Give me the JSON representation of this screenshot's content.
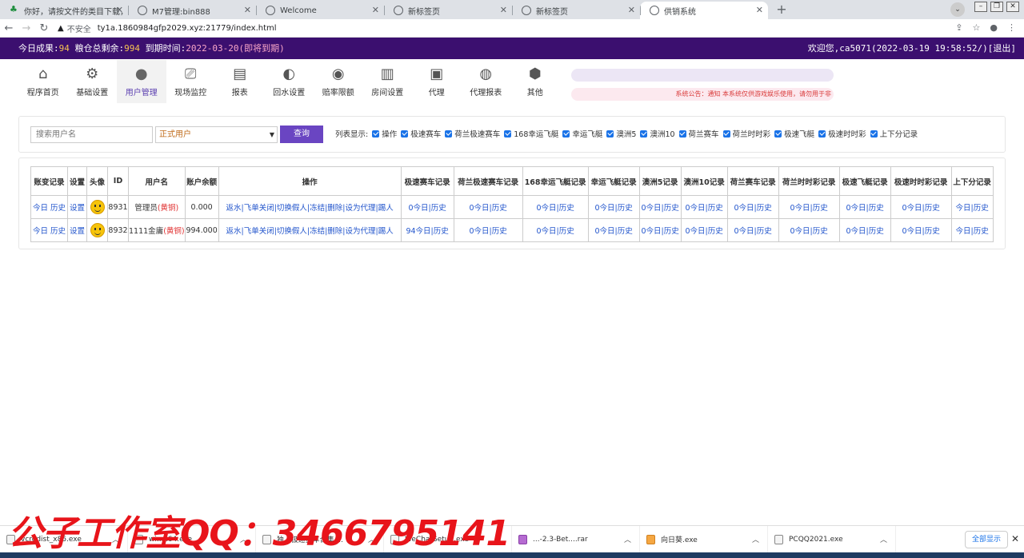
{
  "browser": {
    "tabs": [
      {
        "title": "你好，请按文件的类目下载，对…",
        "icon": "tree-icon"
      },
      {
        "title": "M7管理:bin888",
        "icon": "globe-icon"
      },
      {
        "title": "Welcome",
        "icon": "globe-icon"
      },
      {
        "title": "新标签页",
        "icon": "globe-icon"
      },
      {
        "title": "新标签页",
        "icon": "globe-icon"
      },
      {
        "title": "供销系统",
        "icon": "globe-icon",
        "active": true
      }
    ],
    "insecure_label": "不安全",
    "url": "ty1a.1860984gfp2029.xyz:21779/index.html"
  },
  "status_bar": {
    "today_label": "今日成果:",
    "today_value": "94",
    "grain_label": "粮仓总剩余:",
    "grain_value": "994",
    "expire_label": "到期时间:",
    "expire_value": "2022-03-20(即将到期)",
    "welcome": "欢迎您,ca5071(2022-03-19 19:58:52/)",
    "logout": "[退出]"
  },
  "nav": [
    {
      "label": "程序首页",
      "icon": "home-icon"
    },
    {
      "label": "基础设置",
      "icon": "gear-icon"
    },
    {
      "label": "用户管理",
      "icon": "user-icon",
      "active": true
    },
    {
      "label": "现场监控",
      "icon": "camera-icon"
    },
    {
      "label": "报表",
      "icon": "clipboard-icon"
    },
    {
      "label": "回水设置",
      "icon": "coin-icon"
    },
    {
      "label": "赔率限额",
      "icon": "car-icon"
    },
    {
      "label": "房间设置",
      "icon": "door-icon"
    },
    {
      "label": "代理",
      "icon": "agent-icon"
    },
    {
      "label": "代理报表",
      "icon": "chart-icon"
    },
    {
      "label": "其他",
      "icon": "box-icon"
    }
  ],
  "notice": "系统公告：通知 本系统仅供游戏娱乐使用，请勿用于非",
  "filter": {
    "search_placeholder": "搜索用户名",
    "user_type": "正式用户",
    "query_button": "查询",
    "columns_label": "列表显示:",
    "columns": [
      "操作",
      "极速赛车",
      "荷兰极速赛车",
      "168幸运飞艇",
      "幸运飞艇",
      "澳洲5",
      "澳洲10",
      "荷兰赛车",
      "荷兰时时彩",
      "极速飞艇",
      "极速时时彩",
      "上下分记录"
    ]
  },
  "table": {
    "headers": [
      "账变记录",
      "设置",
      "头像",
      "ID",
      "用户名",
      "账户余额",
      "操作",
      "极速赛车记录",
      "荷兰极速赛车记录",
      "168幸运飞艇记录",
      "幸运飞艇记录",
      "澳洲5记录",
      "澳洲10记录",
      "荷兰赛车记录",
      "荷兰时时彩记录",
      "极速飞艇记录",
      "极速时时彩记录",
      "上下分记录"
    ],
    "today": "今日",
    "history": "历史",
    "settings": "设置",
    "actions": "返水|飞单关闭|切换假人|冻结|删除|设为代理|踢人",
    "rows": [
      {
        "id": "8931",
        "username": "管理员",
        "tag": "(黄铜)",
        "balance": "0.000",
        "first_prefix": "0"
      },
      {
        "id": "8932",
        "username": "1111金庸",
        "tag": "(黄铜)",
        "balance": "994.000",
        "first_prefix": "94"
      }
    ],
    "record_prefix": "0"
  },
  "downloads": [
    {
      "name": "vcredist_x86.exe",
      "type": "exe"
    },
    {
      "name": "wi...x64.exe",
      "type": "exe"
    },
    {
      "name": "独...极速赛车合集....",
      "type": "doc"
    },
    {
      "name": "WeChatSetup.exe",
      "type": "exe"
    },
    {
      "name": "...-2.3-Bet....rar",
      "type": "rar"
    },
    {
      "name": "向日葵.exe",
      "type": "app"
    },
    {
      "name": "PCQQ2021.exe",
      "type": "exe"
    }
  ],
  "show_all": "全部显示",
  "watermark": "公子工作室QQ：3466795141"
}
